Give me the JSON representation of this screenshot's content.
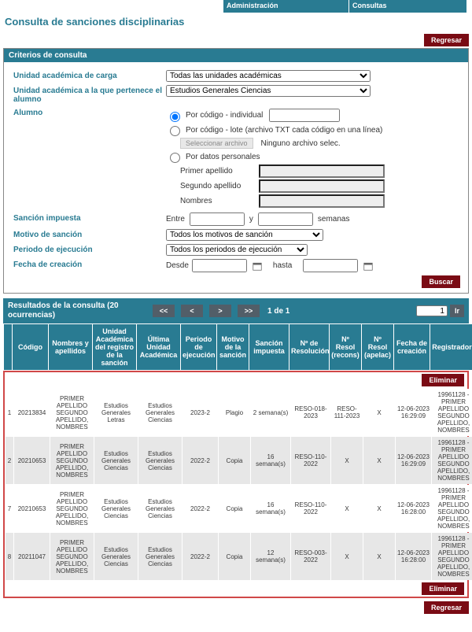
{
  "nav": {
    "admin": "Administración",
    "consultas": "Consultas"
  },
  "page_title": "Consulta de sanciones disciplinarias",
  "btn": {
    "regresar": "Regresar",
    "buscar": "Buscar",
    "eliminar": "Eliminar",
    "ir": "Ir",
    "first": "<<",
    "prev": "<",
    "next": ">",
    "last": ">>"
  },
  "criteria": {
    "header": "Criterios de consulta",
    "unidad_carga_label": "Unidad académica de carga",
    "unidad_carga_value": "Todas las unidades académicas",
    "unidad_pert_label": "Unidad académica a la que pertenece el alumno",
    "unidad_pert_value": "Estudios Generales Ciencias",
    "alumno_label": "Alumno",
    "r1": "Por código - individual",
    "r2": "Por código - lote (archivo TXT cada código en una línea)",
    "sel_archivo": "Seleccionar archivo",
    "no_archivo": "Ninguno archivo selec.",
    "r3": "Por datos personales",
    "primer_apellido": "Primer apellido",
    "segundo_apellido": "Segundo apellido",
    "nombres": "Nombres",
    "sancion_label": "Sanción impuesta",
    "entre": "Entre",
    "y": "y",
    "semanas": "semanas",
    "motivo_label": "Motivo de sanción",
    "motivo_value": "Todos los motivos de sanción",
    "periodo_label": "Periodo de ejecución",
    "periodo_value": "Todos los periodos de ejecución",
    "fecha_label": "Fecha de creación",
    "desde": "Desde",
    "hasta": "hasta"
  },
  "results": {
    "header": "Resultados de la consulta (20 ocurrencias)",
    "page_info": "1 de 1",
    "page_input": "1",
    "cols": {
      "codigo": "Código",
      "nombres": "Nombres y apellidos",
      "ureg": "Unidad Académica del registro de la sanción",
      "ult": "Última Unidad Académica",
      "periodo": "Periodo de ejecución",
      "motivo": "Motivo de la sanción",
      "sancion": "Sanción impuesta",
      "reso": "Nº de Resolución",
      "recons": "Nº Resol (recons)",
      "apelac": "Nº Resol (apelac)",
      "fecha": "Fecha de creación",
      "registrador": "Registrador",
      "chk": ""
    },
    "rows": [
      {
        "idx": "1",
        "codigo": "20213834",
        "nom": "PRIMER APELLIDO SEGUNDO APELLIDO, NOMBRES",
        "ureg": "Estudios Generales Letras",
        "ult": "Estudios Generales Ciencias",
        "per": "2023-2",
        "mot": "Plagio",
        "san": "2 semana(s)",
        "reso": "RESO-018-2023",
        "rec": "RESO-111-2023",
        "ape": "X",
        "fec": "12-06-2023 16:29:09",
        "reg": "19961128 - PRIMER APELLIDO SEGUNDO APELLIDO, NOMBRES"
      },
      {
        "idx": "2",
        "codigo": "20210653",
        "nom": "PRIMER APELLIDO SEGUNDO APELLIDO, NOMBRES",
        "ureg": "Estudios Generales Ciencias",
        "ult": "Estudios Generales Ciencias",
        "per": "2022-2",
        "mot": "Copia",
        "san": "16 semana(s)",
        "reso": "RESO-110-2022",
        "rec": "X",
        "ape": "X",
        "fec": "12-06-2023 16:29:09",
        "reg": "19961128 - PRIMER APELLIDO SEGUNDO APELLIDO, NOMBRES"
      },
      {
        "idx": "7",
        "codigo": "20210653",
        "nom": "PRIMER APELLIDO SEGUNDO APELLIDO, NOMBRES",
        "ureg": "Estudios Generales Ciencias",
        "ult": "Estudios Generales Ciencias",
        "per": "2022-2",
        "mot": "Copia",
        "san": "16 semana(s)",
        "reso": "RESO-110-2022",
        "rec": "X",
        "ape": "X",
        "fec": "12-06-2023 16:28:00",
        "reg": "19961128 - PRIMER APELLIDO SEGUNDO APELLIDO, NOMBRES"
      },
      {
        "idx": "8",
        "codigo": "20211047",
        "nom": "PRIMER APELLIDO SEGUNDO APELLIDO, NOMBRES",
        "ureg": "Estudios Generales Ciencias",
        "ult": "Estudios Generales Ciencias",
        "per": "2022-2",
        "mot": "Copia",
        "san": "12 semana(s)",
        "reso": "RESO-003-2022",
        "rec": "X",
        "ape": "X",
        "fec": "12-06-2023 16:28:00",
        "reg": "19961128 - PRIMER APELLIDO SEGUNDO APELLIDO, NOMBRES"
      }
    ]
  }
}
